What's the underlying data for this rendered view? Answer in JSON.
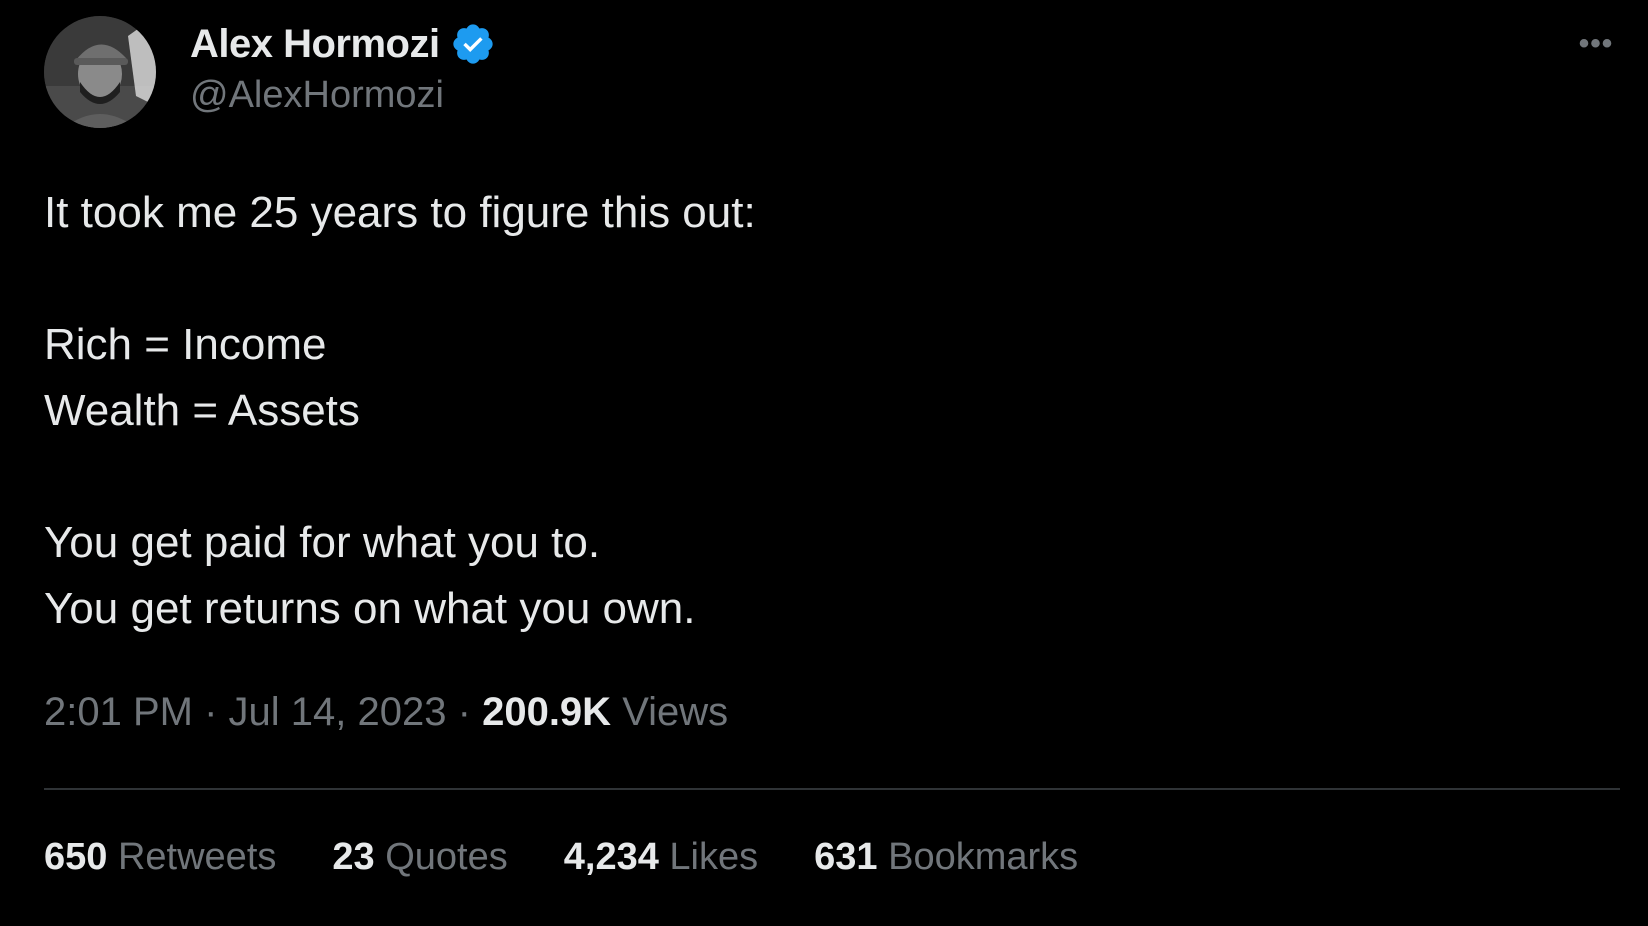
{
  "author": {
    "name": "Alex Hormozi",
    "handle": "@AlexHormozi",
    "verified_icon": "verified-badge-icon",
    "verified_color": "#1d9bf0"
  },
  "more_icon": "more-horizontal-icon",
  "more_label": "•••",
  "tweet": {
    "lines": [
      "It took me 25 years to figure this out:",
      "",
      "Rich = Income",
      "Wealth = Assets",
      "",
      "You get paid for what you to.",
      "You get returns on what you own."
    ]
  },
  "meta": {
    "time": "2:01 PM",
    "separator": "·",
    "date": "Jul 14, 2023",
    "views_count": "200.9K",
    "views_label": "Views"
  },
  "stats": {
    "retweets": {
      "count": "650",
      "label": "Retweets"
    },
    "quotes": {
      "count": "23",
      "label": "Quotes"
    },
    "likes": {
      "count": "4,234",
      "label": "Likes"
    },
    "bookmarks": {
      "count": "631",
      "label": "Bookmarks"
    }
  },
  "colors": {
    "background": "#000000",
    "primary_text": "#e7e9ea",
    "secondary_text": "#71767b",
    "divider": "#2f3336",
    "accent": "#1d9bf0"
  }
}
